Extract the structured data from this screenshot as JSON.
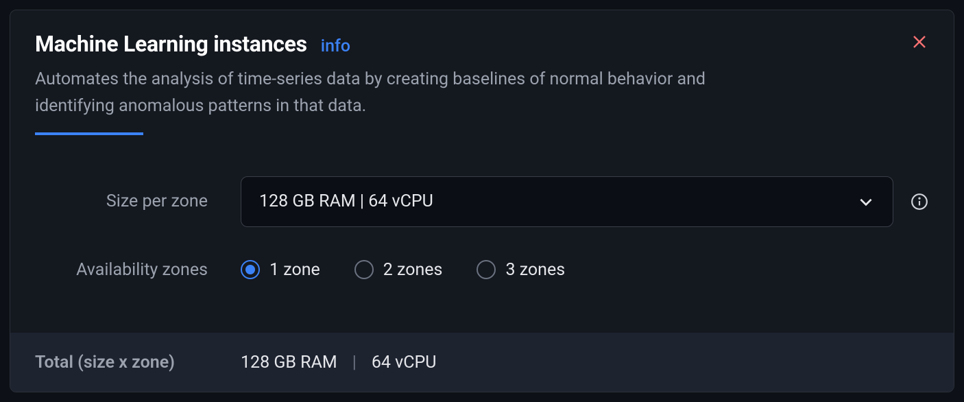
{
  "header": {
    "title": "Machine Learning instances",
    "info_link": "info",
    "description": "Automates the analysis of time-series data by creating baselines of normal behavior and identifying anomalous patterns in that data."
  },
  "size_per_zone": {
    "label": "Size per zone",
    "selected": "128 GB RAM | 64 vCPU"
  },
  "availability_zones": {
    "label": "Availability zones",
    "options": [
      {
        "label": "1 zone",
        "selected": true
      },
      {
        "label": "2 zones",
        "selected": false
      },
      {
        "label": "3 zones",
        "selected": false
      }
    ]
  },
  "total": {
    "label": "Total (size x zone)",
    "ram": "128 GB RAM",
    "cpu": "64 vCPU"
  }
}
